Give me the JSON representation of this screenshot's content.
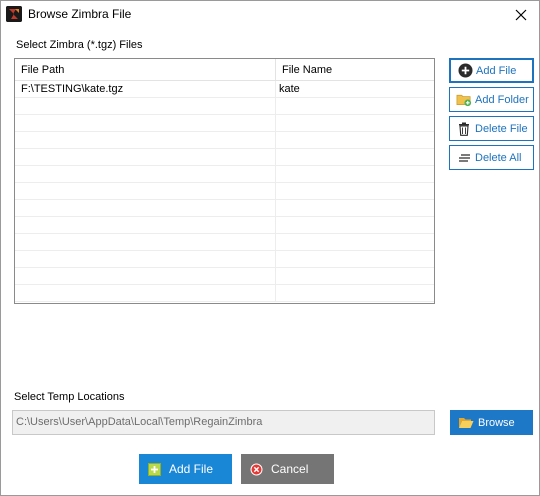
{
  "window": {
    "title": "Browse Zimbra File"
  },
  "files_section": {
    "label": "Select Zimbra (*.tgz) Files",
    "columns": [
      "File Path",
      "File Name"
    ],
    "rows": [
      {
        "path": "F:\\TESTING\\kate.tgz",
        "name": "kate"
      },
      {
        "path": "",
        "name": ""
      },
      {
        "path": "",
        "name": ""
      },
      {
        "path": "",
        "name": ""
      },
      {
        "path": "",
        "name": ""
      },
      {
        "path": "",
        "name": ""
      },
      {
        "path": "",
        "name": ""
      },
      {
        "path": "",
        "name": ""
      },
      {
        "path": "",
        "name": ""
      },
      {
        "path": "",
        "name": ""
      },
      {
        "path": "",
        "name": ""
      },
      {
        "path": "",
        "name": ""
      },
      {
        "path": "",
        "name": ""
      }
    ]
  },
  "side_buttons": {
    "add_file": "Add File",
    "add_folder": "Add Folder",
    "delete_file": "Delete File",
    "delete_all": "Delete All"
  },
  "temp_section": {
    "label": "Select Temp Locations",
    "path_value": "C:\\Users\\User\\AppData\\Local\\Temp\\RegainZimbra",
    "browse_label": "Browse"
  },
  "footer": {
    "add_file_label": "Add File",
    "cancel_label": "Cancel"
  },
  "colors": {
    "accent": "#1e73be",
    "primary_button": "#1a86d6",
    "secondary_button": "#757575",
    "folder_icon": "#f0c24b"
  },
  "icons": {
    "app": "regain-zimbra-app-icon",
    "close": "close-icon",
    "add_file": "plus-circle-icon",
    "add_folder": "folder-add-icon",
    "delete_file": "trash-icon",
    "delete_all": "delete-all-icon",
    "browse": "folder-open-icon",
    "footer_add": "plus-square-icon",
    "footer_cancel": "cancel-icon"
  }
}
